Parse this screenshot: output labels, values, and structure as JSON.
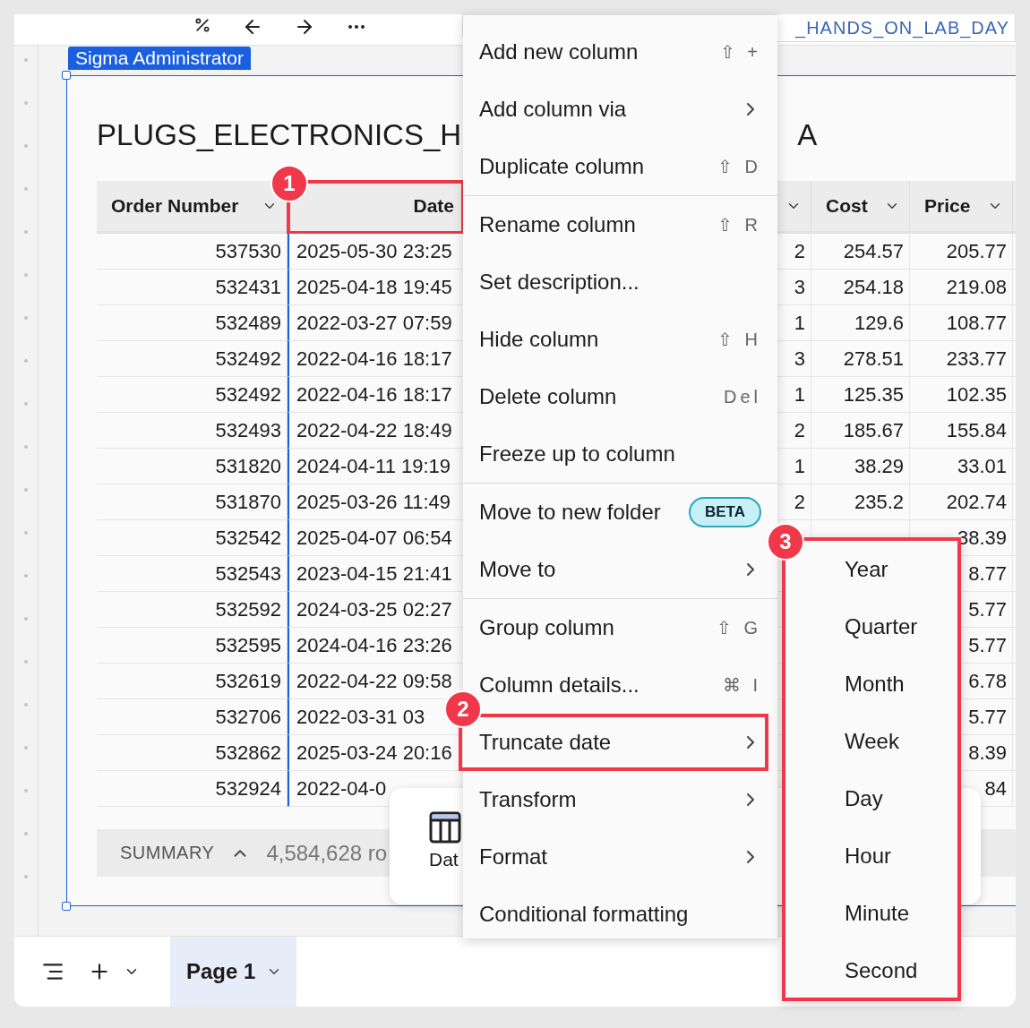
{
  "toolbar": {
    "field_text": "_HANDS_ON_LAB_DAY"
  },
  "element_tag": "Sigma Administrator",
  "title": "PLUGS_ELECTRONICS_H",
  "title_end": "A",
  "table": {
    "columns": [
      {
        "label": "Order Number",
        "dropdown": true
      },
      {
        "label": "Date",
        "dropdown": false,
        "annotation": "1"
      },
      {
        "dropdown": true
      },
      {
        "label": "Cost",
        "dropdown": true
      },
      {
        "label": "Price",
        "dropdown": true
      }
    ],
    "rows": [
      [
        "537530",
        "2025-05-30 23:25",
        "2",
        "254.57",
        "205.77"
      ],
      [
        "532431",
        "2025-04-18 19:45",
        "3",
        "254.18",
        "219.08"
      ],
      [
        "532489",
        "2022-03-27 07:59",
        "1",
        "129.6",
        "108.77"
      ],
      [
        "532492",
        "2022-04-16 18:17",
        "3",
        "278.51",
        "233.77"
      ],
      [
        "532492",
        "2022-04-16 18:17",
        "1",
        "125.35",
        "102.35"
      ],
      [
        "532493",
        "2022-04-22 18:49",
        "2",
        "185.67",
        "155.84"
      ],
      [
        "531820",
        "2024-04-11 19:19",
        "1",
        "38.29",
        "33.01"
      ],
      [
        "531870",
        "2025-03-26 11:49",
        "2",
        "235.2",
        "202.74"
      ],
      [
        "532542",
        "2025-04-07 06:54",
        null,
        null,
        "38.39"
      ],
      [
        "532543",
        "2023-04-15 21:41",
        null,
        null,
        "8.77"
      ],
      [
        "532592",
        "2024-03-25 02:27",
        null,
        null,
        "5.77"
      ],
      [
        "532595",
        "2024-04-16 23:26",
        null,
        null,
        "5.77"
      ],
      [
        "532619",
        "2022-04-22 09:58",
        null,
        null,
        "6.78"
      ],
      [
        "532706",
        "2022-03-31 03",
        null,
        null,
        "5.77"
      ],
      [
        "532862",
        "2025-03-24 20:16",
        null,
        null,
        "8.39"
      ],
      [
        "532924",
        "2022-04-0",
        null,
        null,
        "84"
      ]
    ],
    "summary": {
      "label": "SUMMARY",
      "row_count": "4,584,628 ro"
    }
  },
  "popup": {
    "label": "Dat"
  },
  "menu": [
    [
      {
        "label": "Add new column",
        "shortcut": "⇧ +"
      },
      {
        "label": "Add column via",
        "submenu": true
      },
      {
        "label": "Duplicate column",
        "shortcut": "⇧ D"
      }
    ],
    [
      {
        "label": "Rename column",
        "shortcut": "⇧ R"
      },
      {
        "label": "Set description..."
      },
      {
        "label": "Hide column",
        "shortcut": "⇧ H"
      },
      {
        "label": "Delete column",
        "shortcut": "Del"
      },
      {
        "label": "Freeze up to column"
      }
    ],
    [
      {
        "label": "Move to new folder",
        "badge": "BETA"
      },
      {
        "label": "Move to",
        "submenu": true
      }
    ],
    [
      {
        "label": "Group column",
        "shortcut": "⇧ G"
      },
      {
        "label": "Column details...",
        "shortcut": "⌘ I"
      },
      {
        "label": "Truncate date",
        "submenu": true,
        "annotation": "2"
      },
      {
        "label": "Transform",
        "submenu": true
      },
      {
        "label": "Format",
        "submenu": true
      },
      {
        "label": "Conditional formatting"
      }
    ]
  ],
  "submenu": {
    "annotation": "3",
    "items": [
      "Year",
      "Quarter",
      "Month",
      "Week",
      "Day",
      "Hour",
      "Minute",
      "Second"
    ]
  },
  "pages": [
    {
      "label": "Page 1",
      "selected": true
    }
  ]
}
